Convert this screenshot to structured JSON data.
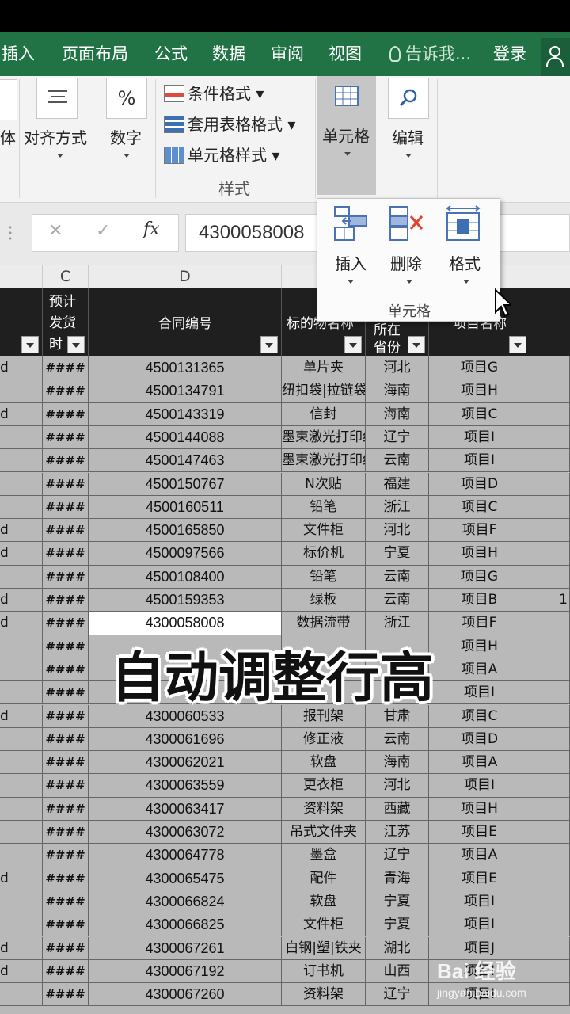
{
  "ribbon_tabs": {
    "insert": "插入",
    "page_layout": "页面布局",
    "formulas": "公式",
    "data": "数据",
    "review": "审阅",
    "view": "视图",
    "tell_me": "告诉我...",
    "login": "登录"
  },
  "ribbon": {
    "partial_label": "体",
    "alignment": "对齐方式",
    "number": "数字",
    "percent_symbol": "%",
    "conditional_formatting": "条件格式",
    "format_as_table": "套用表格格式",
    "cell_styles": "单元格样式",
    "styles_group": "样式",
    "cells": "单元格",
    "editing": "编辑"
  },
  "cells_dropdown": {
    "insert": "插入",
    "delete": "删除",
    "format": "格式",
    "group_label": "单元格"
  },
  "formula_bar": {
    "cancel_glyph": "✕",
    "enter_glyph": "✓",
    "fx_glyph": "fx",
    "value": "4300058008"
  },
  "columns": [
    "C",
    "D"
  ],
  "table_headers": {
    "c": "预计\n发货\n时",
    "d": "合同编号",
    "e": "标的物名称",
    "f": "所在省份",
    "g": "项目名称"
  },
  "rows": [
    {
      "b": "d",
      "c": "####",
      "d": "4500131365",
      "e": "单片夹",
      "f": "河北",
      "g": "项目G",
      "h": ""
    },
    {
      "b": "",
      "c": "####",
      "d": "4500134791",
      "e": "纽扣袋|拉链袋",
      "f": "海南",
      "g": "项目H",
      "h": ""
    },
    {
      "b": "d",
      "c": "####",
      "d": "4500143319",
      "e": "信封",
      "f": "海南",
      "g": "项目C",
      "h": ""
    },
    {
      "b": "",
      "c": "####",
      "d": "4500144088",
      "e": "墨束激光打印纸",
      "f": "辽宁",
      "g": "项目I",
      "h": ""
    },
    {
      "b": "",
      "c": "####",
      "d": "4500147463",
      "e": "墨束激光打印纸",
      "f": "云南",
      "g": "项目I",
      "h": ""
    },
    {
      "b": "",
      "c": "####",
      "d": "4500150767",
      "e": "N次贴",
      "f": "福建",
      "g": "项目D",
      "h": ""
    },
    {
      "b": "",
      "c": "####",
      "d": "4500160511",
      "e": "铅笔",
      "f": "浙江",
      "g": "项目C",
      "h": ""
    },
    {
      "b": "d",
      "c": "####",
      "d": "4500165850",
      "e": "文件柜",
      "f": "河北",
      "g": "项目F",
      "h": ""
    },
    {
      "b": "d",
      "c": "####",
      "d": "4500097566",
      "e": "标价机",
      "f": "宁夏",
      "g": "项目H",
      "h": ""
    },
    {
      "b": "",
      "c": "####",
      "d": "4500108400",
      "e": "铅笔",
      "f": "云南",
      "g": "项目G",
      "h": ""
    },
    {
      "b": "d",
      "c": "####",
      "d": "4500159353",
      "e": "绿板",
      "f": "云南",
      "g": "项目B",
      "h": "1"
    },
    {
      "b": "d",
      "c": "####",
      "d": "4300058008",
      "e": "数据流带",
      "f": "浙江",
      "g": "项目F",
      "h": "",
      "selected": true
    },
    {
      "b": "",
      "c": "####",
      "d": "",
      "e": "",
      "f": "",
      "g": "项目H",
      "h": ""
    },
    {
      "b": "",
      "c": "####",
      "d": "",
      "e": "",
      "f": "",
      "g": "项目A",
      "h": ""
    },
    {
      "b": "",
      "c": "####",
      "d": "",
      "e": "",
      "f": "",
      "g": "项目I",
      "h": ""
    },
    {
      "b": "d",
      "c": "####",
      "d": "4300060533",
      "e": "报刊架",
      "f": "甘肃",
      "g": "项目C",
      "h": ""
    },
    {
      "b": "",
      "c": "####",
      "d": "4300061696",
      "e": "修正液",
      "f": "云南",
      "g": "项目D",
      "h": ""
    },
    {
      "b": "",
      "c": "####",
      "d": "4300062021",
      "e": "软盘",
      "f": "海南",
      "g": "项目A",
      "h": ""
    },
    {
      "b": "",
      "c": "####",
      "d": "4300063559",
      "e": "更衣柜",
      "f": "河北",
      "g": "项目I",
      "h": ""
    },
    {
      "b": "",
      "c": "####",
      "d": "4300063417",
      "e": "资料架",
      "f": "西藏",
      "g": "项目H",
      "h": ""
    },
    {
      "b": "",
      "c": "####",
      "d": "4300063072",
      "e": "吊式文件夹",
      "f": "江苏",
      "g": "项目E",
      "h": ""
    },
    {
      "b": "",
      "c": "####",
      "d": "4300064778",
      "e": "墨盒",
      "f": "辽宁",
      "g": "项目A",
      "h": ""
    },
    {
      "b": "d",
      "c": "####",
      "d": "4300065475",
      "e": "配件",
      "f": "青海",
      "g": "项目E",
      "h": ""
    },
    {
      "b": "",
      "c": "####",
      "d": "4300066824",
      "e": "软盘",
      "f": "宁夏",
      "g": "项目I",
      "h": ""
    },
    {
      "b": "",
      "c": "####",
      "d": "4300066825",
      "e": "文件柜",
      "f": "宁夏",
      "g": "项目I",
      "h": ""
    },
    {
      "b": "d",
      "c": "####",
      "d": "4300067261",
      "e": "白钢|塑|铁夹",
      "f": "湖北",
      "g": "项目J",
      "h": ""
    },
    {
      "b": "d",
      "c": "####",
      "d": "4300067192",
      "e": "订书机",
      "f": "山西",
      "g": "项目I",
      "h": ""
    },
    {
      "b": "",
      "c": "####",
      "d": "4300067260",
      "e": "资料架",
      "f": "辽宁",
      "g": "项目I",
      "h": ""
    }
  ],
  "overlay_caption": "自动调整行高",
  "watermark": {
    "line1": "Bai 经验",
    "line2": "jingyan.baidu.com"
  },
  "colors": {
    "ribbon_tabs_bg": "#217346",
    "header_row_bg": "#1f1f1f",
    "rows_bg": "#b9b9b9"
  }
}
